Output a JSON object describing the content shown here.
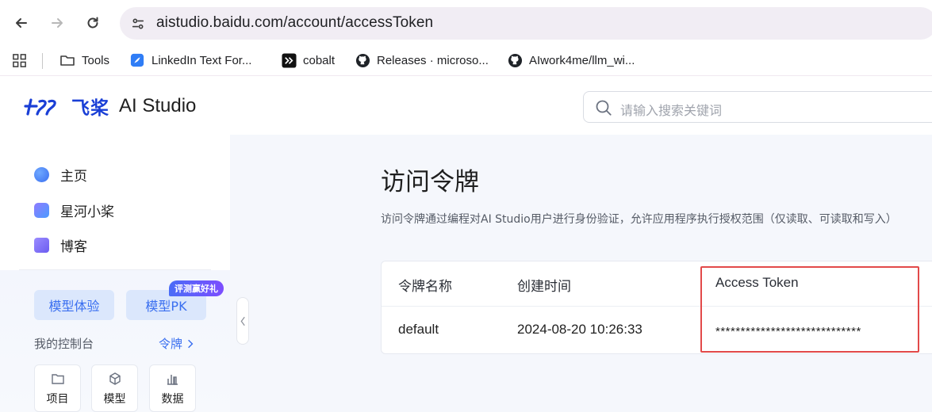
{
  "browser": {
    "url": "aistudio.baidu.com/account/accessToken",
    "bookmarks": [
      {
        "label": "Tools",
        "icon": "folder-icon"
      },
      {
        "label": "LinkedIn Text For...",
        "icon": "feather-icon"
      },
      {
        "label": "cobalt",
        "icon": "terminal-icon"
      },
      {
        "label": "Releases · microso...",
        "icon": "github-icon"
      },
      {
        "label": "AIwork4me/llm_wi...",
        "icon": "github-icon"
      }
    ]
  },
  "header": {
    "brand_cn": "飞桨",
    "brand_en": "AI Studio",
    "search_placeholder": "请输入搜索关键词"
  },
  "sidebar": {
    "items": [
      {
        "label": "主页",
        "color": "#3a6ff0"
      },
      {
        "label": "星河小桨",
        "color": "#6d5cf0"
      },
      {
        "label": "博客",
        "color": "#7b6cf6"
      }
    ],
    "pills": [
      "模型体验",
      "模型PK"
    ],
    "pill_badge": "评测赢好礼",
    "console_label": "我的控制台",
    "console_link": "令牌",
    "shortcuts": [
      "项目",
      "模型",
      "数据"
    ]
  },
  "main": {
    "title": "访问令牌",
    "description": "访问令牌通过编程对AI Studio用户进行身份验证，允许应用程序执行授权范围（仅读取、可读取和写入）",
    "table": {
      "headers": [
        "令牌名称",
        "创建时间",
        "Access Token"
      ],
      "rows": [
        [
          "default",
          "2024-08-20 10:26:33",
          "*****************************"
        ]
      ]
    }
  },
  "colors": {
    "accent": "#3a6ff0",
    "brand": "#1a3fd6",
    "highlight": "#e24a4a"
  }
}
